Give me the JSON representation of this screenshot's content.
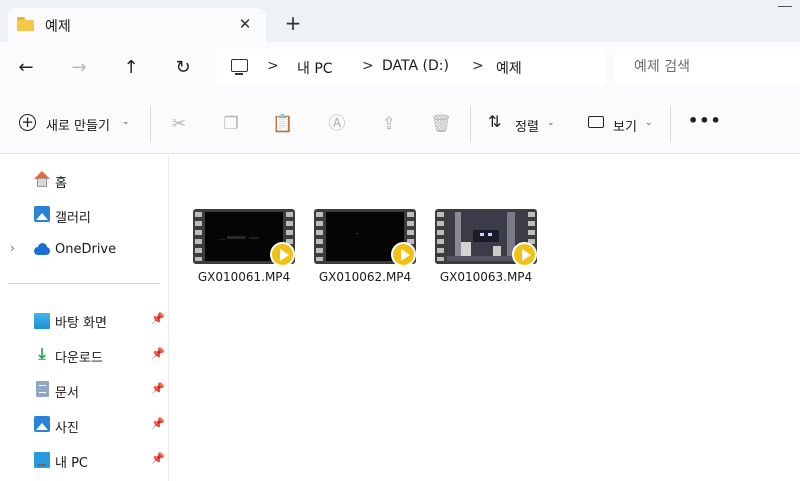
{
  "tab": {
    "title": "예제",
    "close_icon": "close-icon",
    "new_tab_icon": "plus-icon"
  },
  "nav": {
    "back_icon": "arrow-left-icon",
    "forward_icon": "arrow-right-icon",
    "up_icon": "arrow-up-icon",
    "refresh_icon": "refresh-icon"
  },
  "address": {
    "crumbs": [
      "내 PC",
      "DATA (D:)",
      "예제"
    ],
    "separator": ">"
  },
  "search": {
    "placeholder": "예제 검색"
  },
  "toolbar": {
    "new_label": "새로 만들기",
    "sort_label": "정렬",
    "view_label": "보기",
    "more_label": "•••"
  },
  "sidebar": {
    "top_items": [
      {
        "label": "홈",
        "icon": "home-icon"
      },
      {
        "label": "갤러리",
        "icon": "gallery-icon"
      },
      {
        "label": "OneDrive",
        "icon": "onedrive-icon",
        "expandable": true
      }
    ],
    "quick_access": [
      {
        "label": "바탕 화면",
        "icon": "desktop-icon",
        "pinned": true
      },
      {
        "label": "다운로드",
        "icon": "download-icon",
        "pinned": true
      },
      {
        "label": "문서",
        "icon": "documents-icon",
        "pinned": true
      },
      {
        "label": "사진",
        "icon": "pictures-icon",
        "pinned": true
      },
      {
        "label": "내 PC",
        "icon": "this-pc-icon",
        "pinned": true
      }
    ]
  },
  "files": [
    {
      "name": "GX010061.MP4",
      "type": "video",
      "thumb": "dark"
    },
    {
      "name": "GX010062.MP4",
      "type": "video",
      "thumb": "black"
    },
    {
      "name": "GX010063.MP4",
      "type": "video",
      "thumb": "scene"
    }
  ],
  "colors": {
    "play_badge": "#f2c116",
    "folder": "#f5c84a",
    "window_bg": "#eef1f6"
  }
}
